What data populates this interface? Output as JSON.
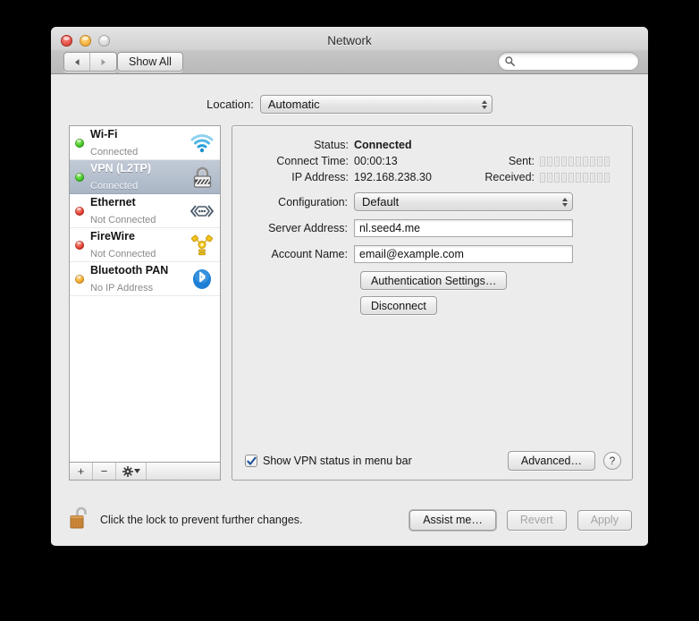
{
  "window": {
    "title": "Network",
    "traffic": {
      "close": "close-button",
      "minimize": "minimize-button",
      "zoom": "zoom-button"
    }
  },
  "toolbar": {
    "back_label": "◀",
    "forward_label": "▶",
    "show_all_label": "Show All",
    "search_placeholder": "",
    "search_value": "",
    "search_icon": "search-icon"
  },
  "location": {
    "label": "Location:",
    "value": "Automatic",
    "options": [
      "Automatic"
    ]
  },
  "services": [
    {
      "name": "Wi-Fi",
      "status": "Connected",
      "dot": "green",
      "icon": "wifi-icon",
      "selected": false
    },
    {
      "name": "VPN (L2TP)",
      "status": "Connected",
      "dot": "green",
      "icon": "vpn-lock-icon",
      "selected": true
    },
    {
      "name": "Ethernet",
      "status": "Not Connected",
      "dot": "red",
      "icon": "ethernet-icon",
      "selected": false
    },
    {
      "name": "FireWire",
      "status": "Not Connected",
      "dot": "red",
      "icon": "firewire-icon",
      "selected": false
    },
    {
      "name": "Bluetooth PAN",
      "status": "No IP Address",
      "dot": "amber",
      "icon": "bluetooth-icon",
      "selected": false
    }
  ],
  "list_toolbar": {
    "add_label": "+",
    "remove_label": "−",
    "gear_label": "gear-icon"
  },
  "detail": {
    "status_label": "Status:",
    "status_value": "Connected",
    "connect_time_label": "Connect Time:",
    "connect_time_value": "00:00:13",
    "ip_address_label": "IP Address:",
    "ip_address_value": "192.168.238.30",
    "sent_label": "Sent:",
    "sent_blocks": 10,
    "sent_filled": 0,
    "received_label": "Received:",
    "received_blocks": 10,
    "received_filled": 0,
    "configuration_label": "Configuration:",
    "configuration_value": "Default",
    "configuration_options": [
      "Default"
    ],
    "server_address_label": "Server Address:",
    "server_address_value": "nl.seed4.me",
    "account_name_label": "Account Name:",
    "account_name_value": "email@example.com",
    "auth_settings_label": "Authentication Settings…",
    "disconnect_label": "Disconnect",
    "show_status_label": "Show VPN status in menu bar",
    "show_status_checked": true,
    "advanced_label": "Advanced…",
    "help_label": "?"
  },
  "footer": {
    "lock_icon": "unlocked-padlock-icon",
    "lock_text": "Click the lock to prevent further changes.",
    "assist_label": "Assist me…",
    "revert_label": "Revert",
    "revert_enabled": false,
    "apply_label": "Apply",
    "apply_enabled": false
  },
  "colors": {
    "selection": "#aab6c6",
    "status_green": "#3cc31d",
    "status_red": "#e0392a",
    "status_amber": "#f5a623",
    "bluetooth_blue": "#1e7fd4",
    "window_bg": "#ebebeb"
  }
}
